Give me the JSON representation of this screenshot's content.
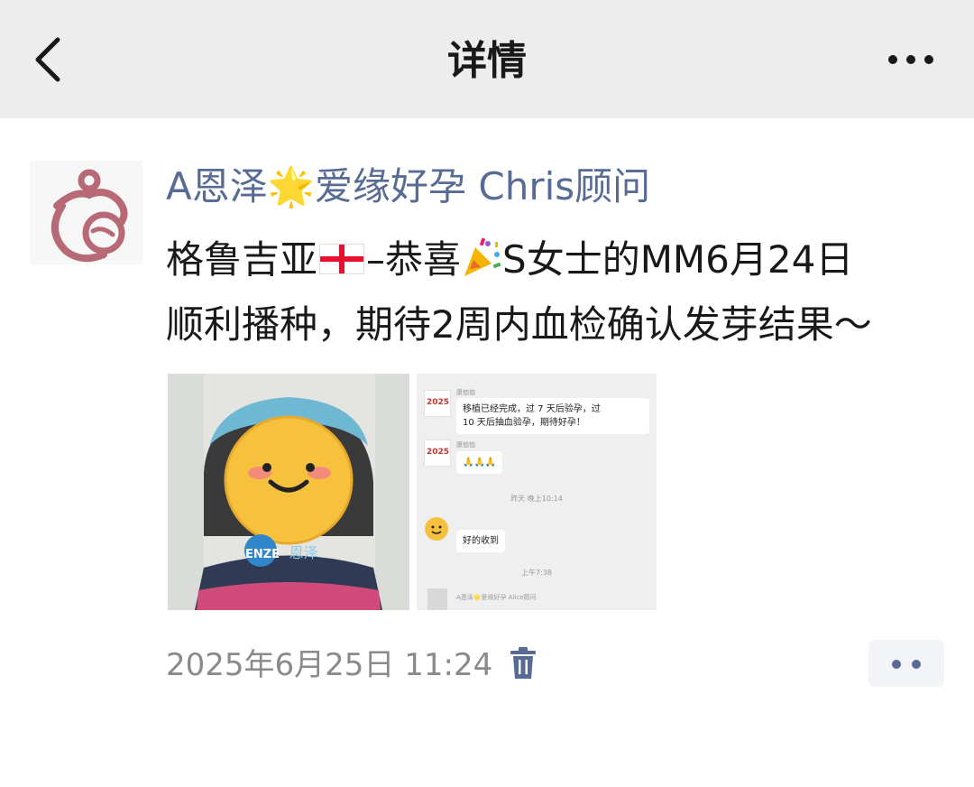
{
  "header": {
    "title": "详情"
  },
  "post": {
    "author": "A恩泽🌟爱缘好孕 Chris顾问",
    "line1_a": "格鲁吉亚",
    "line1_b": "–恭喜",
    "line1_c": "S女士的MM6月24日",
    "line2": "顺利播种，期待2周内血检确认发芽结果～",
    "timestamp": "2025年6月25日 11:24"
  },
  "chat_screenshot": {
    "sender1": "康恤恤",
    "message1_line1": "移植已经完成，过 7 天后验孕，过",
    "message1_line2": "10 天后抽血验孕，期待好孕！",
    "sender2": "康恤恤",
    "message2": "🙏🙏🙏",
    "time1": "昨天 晚上10:14",
    "message3": "好的收到",
    "time2": "上午7:38",
    "sender3": "A恩泽🌟爱缘好孕 Alice顾问",
    "logo_text": "2025"
  },
  "photo_watermark": {
    "badge": "ENZE",
    "text": "恩泽"
  },
  "colors": {
    "link_blue": "#576b95",
    "topbar_bg": "#ededed",
    "avatar_pink": "#b76a75"
  },
  "icons": {
    "back": "chevron-left-icon",
    "more": "more-dots-icon",
    "trash": "trash-icon",
    "comment": "two-dots-comment-icon"
  }
}
